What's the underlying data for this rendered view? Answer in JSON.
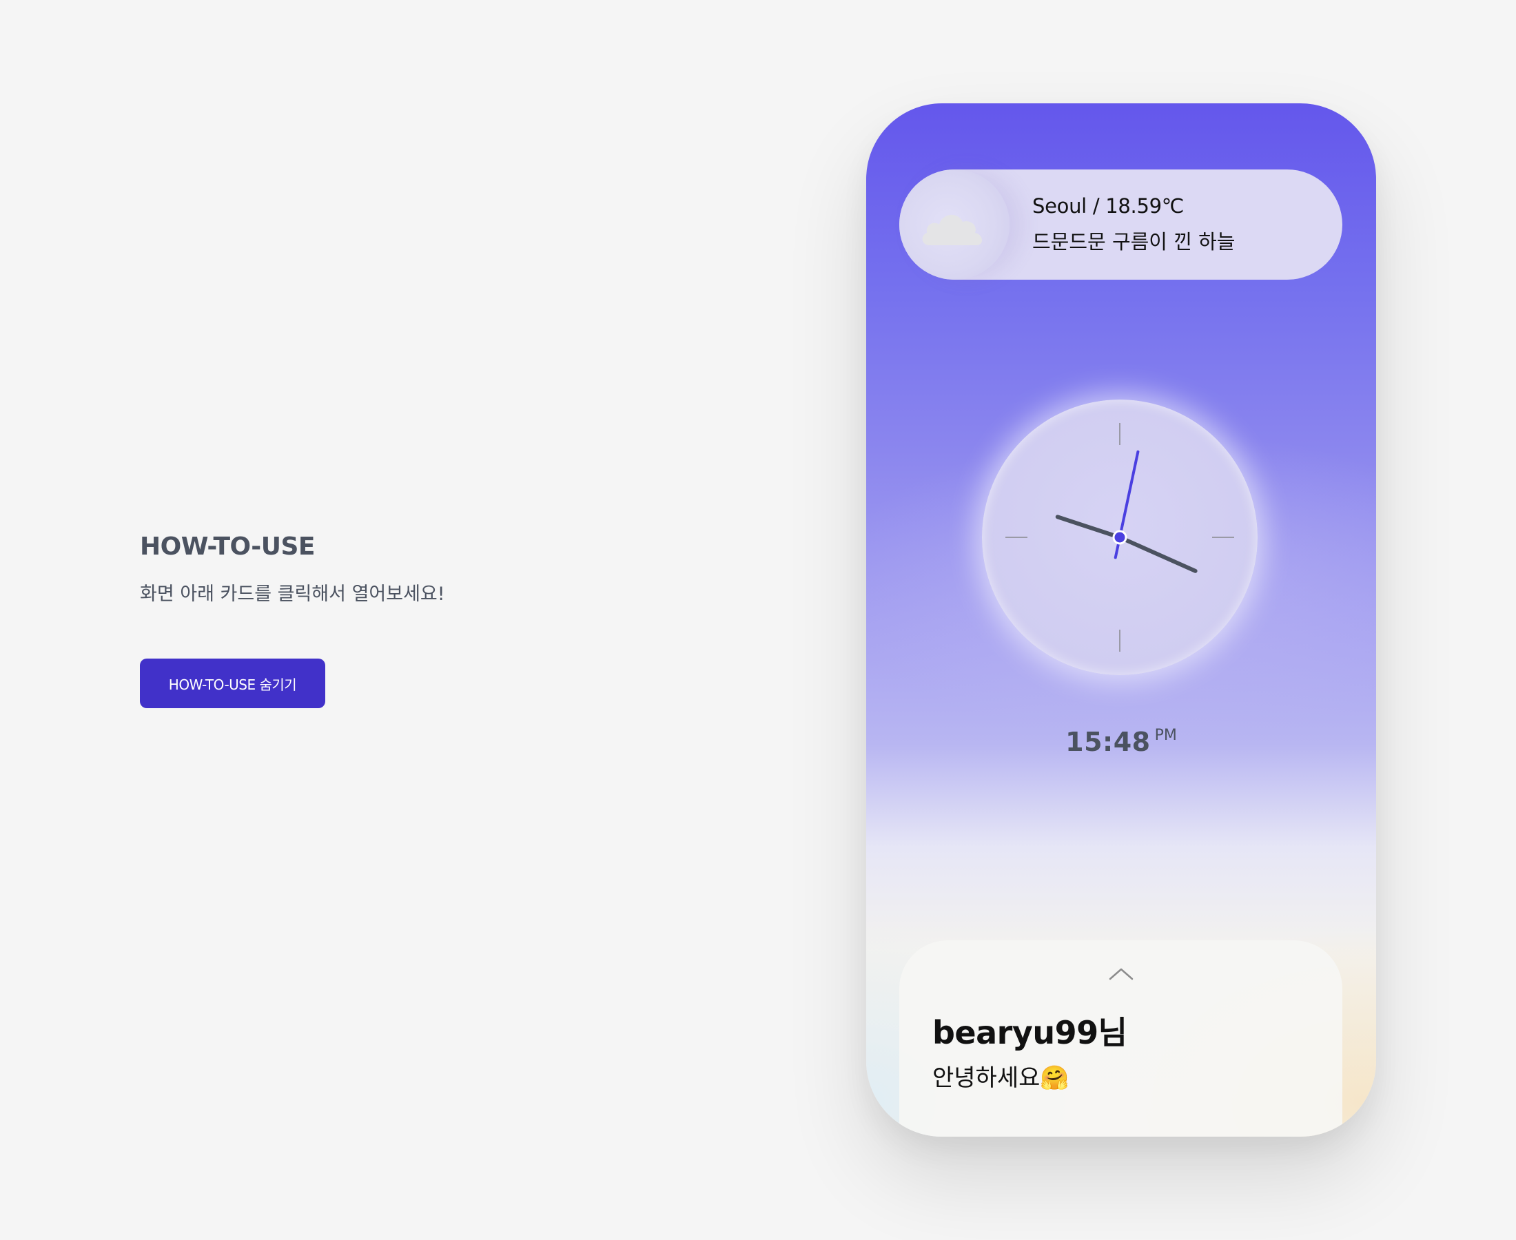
{
  "guide": {
    "title": "HOW-TO-USE",
    "description": "화면 아래 카드를 클릭해서 열어보세요!",
    "hide_button_label": "HOW-TO-USE 숨기기"
  },
  "weather": {
    "location_temp": "Seoul / 18.59℃",
    "condition": "드문드문 구름이 낀 하늘",
    "icon": "cloud-icon"
  },
  "clock": {
    "time": "15:48",
    "ampm": "PM",
    "hour": 15,
    "minute": 48,
    "second": 2
  },
  "card": {
    "name": "bearyu99님",
    "greeting": "안녕하세요🤗",
    "toggle_icon": "chevron-up-icon"
  },
  "colors": {
    "accent": "#4131c9",
    "second_hand": "#4a3fe0",
    "hands": "#4b5260"
  }
}
